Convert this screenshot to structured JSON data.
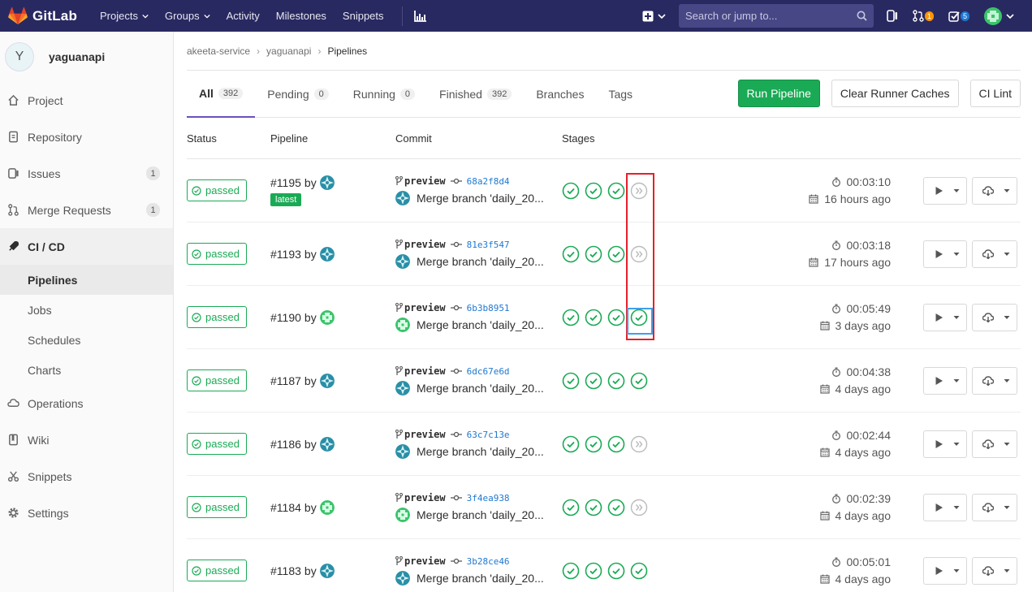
{
  "topnav": {
    "brand": "GitLab",
    "links": [
      {
        "label": "Projects",
        "dropdown": true
      },
      {
        "label": "Groups",
        "dropdown": true
      },
      {
        "label": "Activity",
        "dropdown": false
      },
      {
        "label": "Milestones",
        "dropdown": false
      },
      {
        "label": "Snippets",
        "dropdown": false
      }
    ],
    "search_placeholder": "Search or jump to...",
    "merge_requests_count": "1",
    "todos_count": "5"
  },
  "sidebar": {
    "project_initial": "Y",
    "project_name": "yaguanapi",
    "items": [
      {
        "label": "Project",
        "icon": "home-icon",
        "count": ""
      },
      {
        "label": "Repository",
        "icon": "doc-icon",
        "count": ""
      },
      {
        "label": "Issues",
        "icon": "issues-icon",
        "count": "1"
      },
      {
        "label": "Merge Requests",
        "icon": "merge-icon",
        "count": "1"
      },
      {
        "label": "CI / CD",
        "icon": "rocket-icon",
        "count": ""
      }
    ],
    "sub_items": [
      "Pipelines",
      "Jobs",
      "Schedules",
      "Charts"
    ],
    "lower_items": [
      {
        "label": "Operations",
        "icon": "cloud-icon"
      },
      {
        "label": "Wiki",
        "icon": "book-icon"
      },
      {
        "label": "Snippets",
        "icon": "scissors-icon"
      },
      {
        "label": "Settings",
        "icon": "gear-icon"
      }
    ]
  },
  "breadcrumb": [
    "akeeta-service",
    "yaguanapi",
    "Pipelines"
  ],
  "tabs": [
    {
      "label": "All",
      "count": "392"
    },
    {
      "label": "Pending",
      "count": "0"
    },
    {
      "label": "Running",
      "count": "0"
    },
    {
      "label": "Finished",
      "count": "392"
    },
    {
      "label": "Branches",
      "count": ""
    },
    {
      "label": "Tags",
      "count": ""
    }
  ],
  "actions": {
    "run_pipeline": "Run Pipeline",
    "clear_caches": "Clear Runner Caches",
    "ci_lint": "CI Lint"
  },
  "columns": [
    "Status",
    "Pipeline",
    "Commit",
    "Stages"
  ],
  "pipelines": [
    {
      "status": "passed",
      "id": "#1195",
      "by": "by",
      "latest": "latest",
      "branch": "preview",
      "sha": "68a2f8d4",
      "message": "Merge branch 'daily_20...",
      "stages": [
        "success",
        "success",
        "success",
        "skipped"
      ],
      "duration": "00:03:10",
      "finished": "16 hours ago",
      "avatar": "teal"
    },
    {
      "status": "passed",
      "id": "#1193",
      "by": "by",
      "latest": "",
      "branch": "preview",
      "sha": "81e3f547",
      "message": "Merge branch 'daily_20...",
      "stages": [
        "success",
        "success",
        "success",
        "skipped"
      ],
      "duration": "00:03:18",
      "finished": "17 hours ago",
      "avatar": "teal"
    },
    {
      "status": "passed",
      "id": "#1190",
      "by": "by",
      "latest": "",
      "branch": "preview",
      "sha": "6b3b8951",
      "message": "Merge branch 'daily_20...",
      "stages": [
        "success",
        "success",
        "success",
        "success"
      ],
      "duration": "00:05:49",
      "finished": "3 days ago",
      "avatar": "green"
    },
    {
      "status": "passed",
      "id": "#1187",
      "by": "by",
      "latest": "",
      "branch": "preview",
      "sha": "6dc67e6d",
      "message": "Merge branch 'daily_20...",
      "stages": [
        "success",
        "success",
        "success",
        "success"
      ],
      "duration": "00:04:38",
      "finished": "4 days ago",
      "avatar": "teal"
    },
    {
      "status": "passed",
      "id": "#1186",
      "by": "by",
      "latest": "",
      "branch": "preview",
      "sha": "63c7c13e",
      "message": "Merge branch 'daily_20...",
      "stages": [
        "success",
        "success",
        "success",
        "skipped"
      ],
      "duration": "00:02:44",
      "finished": "4 days ago",
      "avatar": "teal"
    },
    {
      "status": "passed",
      "id": "#1184",
      "by": "by",
      "latest": "",
      "branch": "preview",
      "sha": "3f4ea938",
      "message": "Merge branch 'daily_20...",
      "stages": [
        "success",
        "success",
        "success",
        "skipped"
      ],
      "duration": "00:02:39",
      "finished": "4 days ago",
      "avatar": "green"
    },
    {
      "status": "passed",
      "id": "#1183",
      "by": "by",
      "latest": "",
      "branch": "preview",
      "sha": "3b28ce46",
      "message": "Merge branch 'daily_20...",
      "stages": [
        "success",
        "success",
        "success",
        "success"
      ],
      "duration": "00:05:01",
      "finished": "4 days ago",
      "avatar": "teal"
    }
  ],
  "colors": {
    "nav_bg": "#292961",
    "success": "#1aaa55",
    "link": "#1f78d1",
    "highlight_red": "#e5202b",
    "highlight_blue": "#3da0e8"
  }
}
